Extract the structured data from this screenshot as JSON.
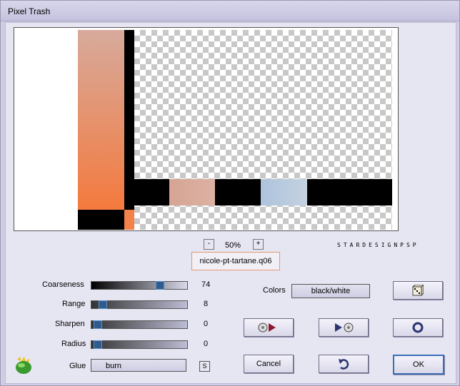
{
  "window": {
    "title": "Pixel Trash"
  },
  "zoom": {
    "minus": "-",
    "value": "50%",
    "plus": "+"
  },
  "brand": {
    "text": "STARDESIGNPSP"
  },
  "preset": {
    "name": "nicole-pt-tartane.q06"
  },
  "controls": {
    "coarseness": {
      "label": "Coarseness",
      "value": "74",
      "level": 0.74
    },
    "range": {
      "label": "Range",
      "value": "8",
      "level": 0.08
    },
    "sharpen": {
      "label": "Sharpen",
      "value": "0",
      "level": 0
    },
    "radius": {
      "label": "Radius",
      "value": "0",
      "level": 0
    },
    "glue": {
      "label": "Glue",
      "value": "burn",
      "toggle": "S"
    }
  },
  "colors": {
    "label": "Colors",
    "value": "black/white"
  },
  "buttons": {
    "cancel": "Cancel",
    "ok": "OK"
  },
  "icons": {
    "dice": "dice-icon",
    "play_back": "play-back-icon",
    "play_forward": "play-forward-icon",
    "ring": "ring-icon",
    "undo": "undo-icon",
    "app_logo": "app-logo-icon"
  }
}
